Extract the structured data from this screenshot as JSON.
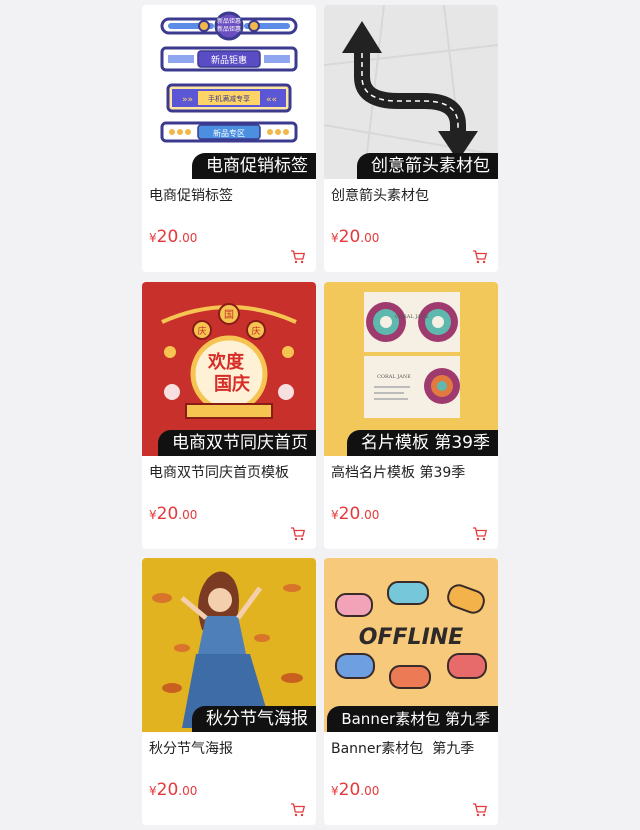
{
  "accent_color": "#e4393c",
  "products": [
    {
      "title": "电商促销标签",
      "tag": "电商促销标签",
      "price_currency": "¥",
      "price_int": "20",
      "price_dec": ".00",
      "cart_icon": "shopping-cart-icon"
    },
    {
      "title": "创意箭头素材包",
      "tag": "创意箭头素材包",
      "price_currency": "¥",
      "price_int": "20",
      "price_dec": ".00",
      "cart_icon": "shopping-cart-icon"
    },
    {
      "title": "电商双节同庆首页模板",
      "tag": "电商双节同庆首页",
      "price_currency": "¥",
      "price_int": "20",
      "price_dec": ".00",
      "cart_icon": "shopping-cart-icon"
    },
    {
      "title": "高档名片模板 第39季",
      "tag": "名片模板 第39季",
      "price_currency": "¥",
      "price_int": "20",
      "price_dec": ".00",
      "cart_icon": "shopping-cart-icon"
    },
    {
      "title": "秋分节气海报",
      "tag": "秋分节气海报",
      "price_currency": "¥",
      "price_int": "20",
      "price_dec": ".00",
      "cart_icon": "shopping-cart-icon"
    },
    {
      "title": "Banner素材包  第九季",
      "tag": "Banner素材包 第九季",
      "price_currency": "¥",
      "price_int": "20",
      "price_dec": ".00",
      "cart_icon": "shopping-cart-icon"
    }
  ],
  "thumb_text": {
    "promo_labels": [
      "新品钜惠",
      "新品钜惠",
      "手机满减专享",
      "新品专区"
    ],
    "festival": [
      "国",
      "庆",
      "庆",
      "欢度",
      "国庆"
    ],
    "card_names": [
      "CORAL JANE",
      "CORAL JANE"
    ],
    "offline": "OFFLINE"
  }
}
